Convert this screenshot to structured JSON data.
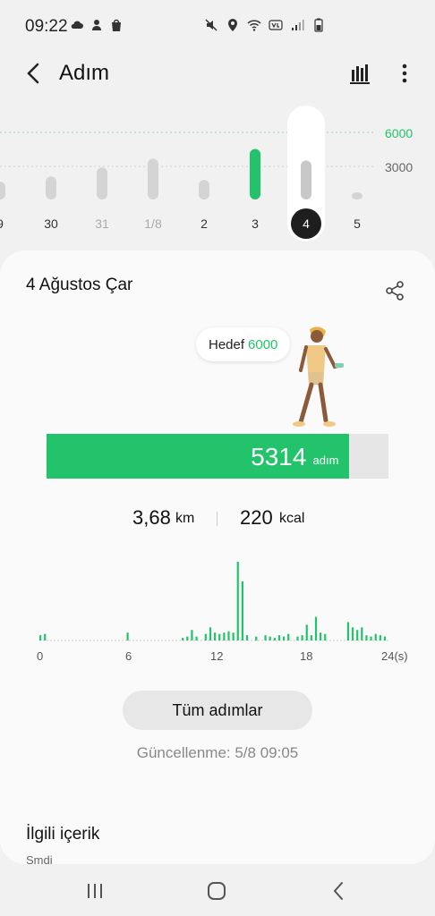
{
  "status": {
    "time": "09:22"
  },
  "header": {
    "title": "Adım"
  },
  "week": {
    "days": [
      {
        "label": "9",
        "value": 1000,
        "muted": false
      },
      {
        "label": "30",
        "value": 1300,
        "muted": false
      },
      {
        "label": "31",
        "value": 1800,
        "muted": true
      },
      {
        "label": "1/8",
        "value": 2300,
        "muted": true
      },
      {
        "label": "2",
        "value": 1100,
        "muted": false
      },
      {
        "label": "3",
        "value": 2850,
        "muted": false
      },
      {
        "label": "4",
        "value": 2200,
        "muted": false,
        "selected": true
      },
      {
        "label": "5",
        "value": 250,
        "muted": false
      }
    ],
    "goal_label": "6000",
    "mid_label": "3000"
  },
  "card": {
    "date": "4 Ağustos Çar",
    "goal_prefix": "Hedef",
    "goal_value": "6000",
    "steps": "5314",
    "steps_unit": "adım",
    "progress_fraction": 0.886,
    "distance_value": "3,68",
    "distance_unit": "km",
    "calorie_value": "220",
    "calorie_unit": "kcal",
    "all_steps_label": "Tüm adımlar",
    "updated": "Güncellenme: 5/8 09:05",
    "related_title": "İlgili içerik",
    "related_sub": "Şmdi"
  },
  "hourly": {
    "axis_labels": [
      "0",
      "6",
      "12",
      "18",
      "24(s)"
    ],
    "values": [
      4,
      5,
      0,
      0,
      0,
      0,
      0,
      0,
      0,
      0,
      0,
      0,
      0,
      0,
      0,
      0,
      0,
      0,
      0,
      6,
      0,
      0,
      0,
      0,
      0,
      0,
      0,
      0,
      0,
      0,
      0,
      2,
      3,
      8,
      3,
      0,
      5,
      10,
      6,
      5,
      6,
      7,
      6,
      60,
      45,
      4,
      0,
      3,
      0,
      4,
      3,
      2,
      4,
      3,
      5,
      0,
      3,
      4,
      12,
      4,
      18,
      6,
      5,
      0,
      0,
      0,
      0,
      14,
      10,
      8,
      10,
      4,
      3,
      5,
      4,
      3
    ],
    "accent": "#22c36a"
  }
}
